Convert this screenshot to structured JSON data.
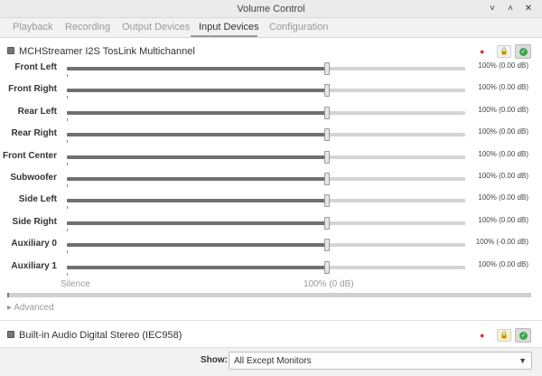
{
  "window": {
    "title": "Volume Control",
    "buttons": [
      "✕",
      "˅",
      "˄"
    ]
  },
  "tabs": [
    {
      "label": "Playback",
      "active": false
    },
    {
      "label": "Recording",
      "active": false
    },
    {
      "label": "Output Devices",
      "active": false
    },
    {
      "label": "Input Devices",
      "active": true
    },
    {
      "label": "Configuration",
      "active": false
    }
  ],
  "devices": [
    {
      "name": "MCHStreamer I2S TosLink Multichannel",
      "channels": [
        {
          "label": "Front Left",
          "level": 0.653,
          "value": "100% (0.00 dB)"
        },
        {
          "label": "Front Right",
          "level": 0.653,
          "value": "100% (0.00 dB)"
        },
        {
          "label": "Rear Left",
          "level": 0.653,
          "value": "100% (0.00 dB)"
        },
        {
          "label": "Rear Right",
          "level": 0.653,
          "value": "100% (0.00 dB)"
        },
        {
          "label": "Front Center",
          "level": 0.653,
          "value": "100% (0.00 dB)"
        },
        {
          "label": "Subwoofer",
          "level": 0.653,
          "value": "100% (0.00 dB)"
        },
        {
          "label": "Side Left",
          "level": 0.653,
          "value": "100% (0.00 dB)"
        },
        {
          "label": "Side Right",
          "level": 0.653,
          "value": "100% (0.00 dB)"
        },
        {
          "label": "Auxiliary 0",
          "level": 0.653,
          "value": "100% (-0.00 dB)"
        },
        {
          "label": "Auxiliary 1",
          "level": 0.653,
          "value": "100% (0.00 dB)"
        }
      ],
      "scale_min": "Silence",
      "scale_mid": "100% (0 dB)",
      "advanced": "Advanced"
    },
    {
      "name": "Built-in Audio Digital Stereo (IEC958)"
    }
  ],
  "footer": {
    "show_label": "Show:",
    "show_value": "All Except Monitors"
  },
  "colors": {
    "default_dot": "#e0312f",
    "ok_green": "#3aa74a"
  },
  "icons": {
    "device": "microphone-icon",
    "lock": "lock-icon",
    "default": "check-circle-icon",
    "expander": "triangle-right-icon",
    "dropdown": "triangle-down-icon"
  }
}
